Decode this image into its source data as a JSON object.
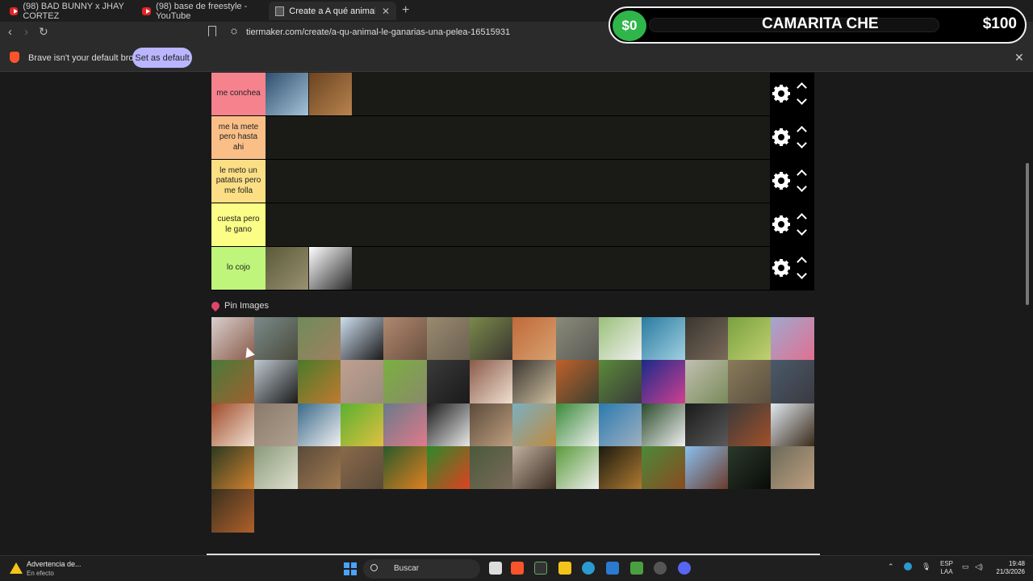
{
  "browser": {
    "tabs": [
      {
        "label": "(98) BAD BUNNY x JHAY CORTEZ",
        "type": "youtube"
      },
      {
        "label": "(98) base de freestyle - YouTube",
        "type": "youtube"
      },
      {
        "label": "Create a A qué animal le ganaria",
        "type": "tiermaker",
        "active": true
      }
    ],
    "new_tab": "+",
    "url": "tiermaker.com/create/a-qu-animal-le-ganarias-una-pelea-16515931",
    "notice_text": "Brave isn't your default browser",
    "notice_button": "Set as default",
    "notice_close": "✕",
    "back": "‹",
    "forward": "›",
    "reload": "↻"
  },
  "overlay": {
    "coin_label": "$0",
    "title": "CAMARITA CHE",
    "max_label": "$100"
  },
  "tiers": [
    {
      "label": "me conchea",
      "color": "#f6828e",
      "images": [
        {
          "name": "whale",
          "c1": "#2e4e6e",
          "c2": "#a6c4d8"
        },
        {
          "name": "bear",
          "c1": "#6b4420",
          "c2": "#b8834f"
        }
      ]
    },
    {
      "label": "me la mete pero hasta ahi",
      "color": "#f9bf87",
      "images": []
    },
    {
      "label": "le meto un patatus pero me folla",
      "color": "#fcdf84",
      "images": []
    },
    {
      "label": "cuesta pero le gano",
      "color": "#fbfd86",
      "images": []
    },
    {
      "label": "lo cojo",
      "color": "#bff57a",
      "images": [
        {
          "name": "sloth",
          "c1": "#5a5a3a",
          "c2": "#9a9070"
        },
        {
          "name": "scorpion",
          "c1": "#ffffff",
          "c2": "#2a2a2a"
        }
      ]
    }
  ],
  "pin_title": "Pin Images",
  "pool": [
    {
      "name": "walrus",
      "c1": "#d8d0cc",
      "c2": "#8a5a4a"
    },
    {
      "name": "emu",
      "c1": "#7a8a8a",
      "c2": "#4a4a3a"
    },
    {
      "name": "kangaroo",
      "c1": "#6f8c5a",
      "c2": "#a08060"
    },
    {
      "name": "penguin",
      "c1": "#cfdff0",
      "c2": "#1a1a1a"
    },
    {
      "name": "elephant",
      "c1": "#b08870",
      "c2": "#6a5040"
    },
    {
      "name": "turtle",
      "c1": "#9a8a70",
      "c2": "#6a6050"
    },
    {
      "name": "buffalo",
      "c1": "#7a8a4a",
      "c2": "#3a3530"
    },
    {
      "name": "meerkat",
      "c1": "#c06a3a",
      "c2": "#d8a070"
    },
    {
      "name": "hippo",
      "c1": "#8a8a7a",
      "c2": "#5a5a55"
    },
    {
      "name": "cow",
      "c1": "#9ac07a",
      "c2": "#f0f0f0"
    },
    {
      "name": "shark",
      "c1": "#2a7aa0",
      "c2": "#a0d0e0"
    },
    {
      "name": "komodo",
      "c1": "#3a3530",
      "c2": "#7a6a5a"
    },
    {
      "name": "chameleon",
      "c1": "#7aa040",
      "c2": "#c0d070"
    },
    {
      "name": "ostrich",
      "c1": "#a0a8d0",
      "c2": "#e07090"
    },
    {
      "name": "deer",
      "c1": "#4a7a3a",
      "c2": "#a06030"
    },
    {
      "name": "crow",
      "c1": "#c0c8d0",
      "c2": "#1a1a1a"
    },
    {
      "name": "squirrel",
      "c1": "#4a7a2a",
      "c2": "#c07a30"
    },
    {
      "name": "armadillo",
      "c1": "#c0a090",
      "c2": "#9a8a80"
    },
    {
      "name": "tortoise",
      "c1": "#7ab040",
      "c2": "#8a8a6a"
    },
    {
      "name": "gorilla",
      "c1": "#3a3a3a",
      "c2": "#1a1a1a"
    },
    {
      "name": "pitbull",
      "c1": "#8a5a4a",
      "c2": "#f0e0d0"
    },
    {
      "name": "badger",
      "c1": "#3a3530",
      "c2": "#d0c0a0"
    },
    {
      "name": "fox",
      "c1": "#c0602a",
      "c2": "#3a4030"
    },
    {
      "name": "anteater",
      "c1": "#5a8a3a",
      "c2": "#3a3a3a"
    },
    {
      "name": "octopus",
      "c1": "#1a2a8a",
      "c2": "#d04090"
    },
    {
      "name": "koala",
      "c1": "#c0c0b0",
      "c2": "#7a8a5a"
    },
    {
      "name": "hyena",
      "c1": "#8a7a5a",
      "c2": "#5a5040"
    },
    {
      "name": "rhino",
      "c1": "#4a5a6a",
      "c2": "#3a3a40"
    },
    {
      "name": "orangutan",
      "c1": "#a04a2a",
      "c2": "#f0e0d0"
    },
    {
      "name": "seal",
      "c1": "#8a7a6a",
      "c2": "#b0a090"
    },
    {
      "name": "polar-bear",
      "c1": "#3a6a8a",
      "c2": "#f0f0f0"
    },
    {
      "name": "parrot",
      "c1": "#5ab030",
      "c2": "#e0c040"
    },
    {
      "name": "flamingo",
      "c1": "#6a7a8a",
      "c2": "#e07a8a"
    },
    {
      "name": "zebra",
      "c1": "#1a1a1a",
      "c2": "#e8e8e8"
    },
    {
      "name": "owl",
      "c1": "#5a4a3a",
      "c2": "#c0a080"
    },
    {
      "name": "giraffe",
      "c1": "#7ab0c0",
      "c2": "#c08a40"
    },
    {
      "name": "panda",
      "c1": "#3a8a3a",
      "c2": "#f0f0f0"
    },
    {
      "name": "dolphin",
      "c1": "#2a7ab0",
      "c2": "#a0b0c0"
    },
    {
      "name": "rabbit",
      "c1": "#2a4a2a",
      "c2": "#f0f0f0"
    },
    {
      "name": "wolf",
      "c1": "#1a1a1a",
      "c2": "#5a5a5a"
    },
    {
      "name": "horse",
      "c1": "#3a3a3a",
      "c2": "#a0502a"
    },
    {
      "name": "eagle",
      "c1": "#e0e8f0",
      "c2": "#3a2a1a"
    },
    {
      "name": "tiger",
      "c1": "#2a3a20",
      "c2": "#d08030"
    },
    {
      "name": "crocodile",
      "c1": "#8a9a7a",
      "c2": "#e0e0d0"
    },
    {
      "name": "lions",
      "c1": "#5a4a3a",
      "c2": "#a07a50"
    },
    {
      "name": "porcupine",
      "c1": "#8a6a4a",
      "c2": "#5a4a3a"
    },
    {
      "name": "toucan",
      "c1": "#2a5a2a",
      "c2": "#e08020"
    },
    {
      "name": "frog",
      "c1": "#2a8a2a",
      "c2": "#e04020"
    },
    {
      "name": "wombat",
      "c1": "#4a5a3a",
      "c2": "#7a6a5a"
    },
    {
      "name": "tarantula",
      "c1": "#c0b0a0",
      "c2": "#3a2a20"
    },
    {
      "name": "lapwing",
      "c1": "#5a9a3a",
      "c2": "#f0f0f0"
    },
    {
      "name": "lion",
      "c1": "#1a1a10",
      "c2": "#b07a30"
    },
    {
      "name": "bull",
      "c1": "#4a8a3a",
      "c2": "#8a4a20"
    },
    {
      "name": "bat",
      "c1": "#8ac0f0",
      "c2": "#6a3a2a"
    },
    {
      "name": "panther",
      "c1": "#2a3a2a",
      "c2": "#0a0a0a"
    },
    {
      "name": "cougar",
      "c1": "#6a6a5a",
      "c2": "#c0a080"
    },
    {
      "name": "orangutan-baby",
      "c1": "#3a3020",
      "c2": "#b0602a"
    }
  ],
  "taskbar": {
    "warning_title": "Advertencia de...",
    "warning_sub": "En efecto",
    "search_label": "Buscar",
    "lang1": "ESP",
    "lang2": "LAA",
    "time": "19:48",
    "date": "21/3/2026"
  }
}
